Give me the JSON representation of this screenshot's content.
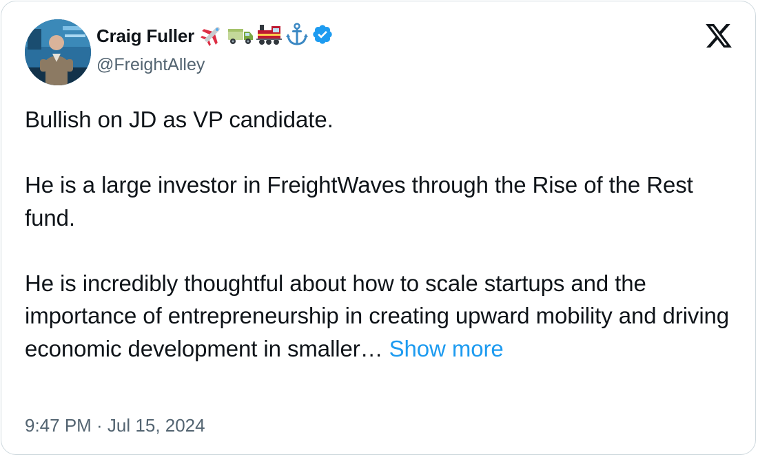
{
  "author": {
    "name": "Craig Fuller",
    "handle": "@FreightAlley",
    "verified": true,
    "badge_color": "#1d9bf0",
    "emoji_icons": [
      "airplane-icon",
      "truck-icon",
      "train-icon",
      "anchor-icon",
      "verified-badge-icon"
    ]
  },
  "tweet": {
    "line1": "Bullish on JD as VP candidate.",
    "line2": "He is a large investor in FreightWaves through the Rise of the Rest fund.",
    "line3": "He is incredibly thoughtful about how to scale startups and the importance of entrepreneurship in creating upward mobility and driving economic development in smaller…",
    "show_more": "Show more"
  },
  "timestamp": "9:47 PM · Jul 15, 2024",
  "colors": {
    "link": "#1d9bf0",
    "text": "#0f1419",
    "muted": "#536471",
    "border": "#cfd9de"
  },
  "platform_logo": "x-logo-icon"
}
